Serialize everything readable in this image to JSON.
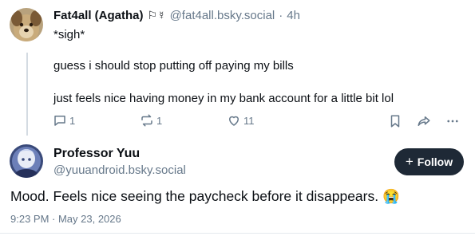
{
  "parent_post": {
    "display_name": "Fat4all (Agatha)",
    "name_flags": "⚐☿",
    "handle": "@fat4all.bsky.social",
    "separator": "·",
    "time_ago": "4h",
    "lines": [
      "*sigh*",
      "guess i should stop putting off paying my bills",
      "just feels nice having money in my bank account for a little bit lol"
    ],
    "actions": {
      "reply_count": "1",
      "repost_count": "1",
      "like_count": "11"
    }
  },
  "main_post": {
    "display_name": "Professor Yuu",
    "handle": "@yuuandroid.bsky.social",
    "follow_label": "Follow",
    "follow_icon": "+",
    "text": "Mood. Feels nice seeing the paycheck before it disappears.",
    "emoji": "😭",
    "timestamp": "9:23 PM · May 23, 2026"
  },
  "colors": {
    "muted": "#66788a",
    "thread_line": "#d4dbe2",
    "follow_bg": "#1e2936"
  }
}
